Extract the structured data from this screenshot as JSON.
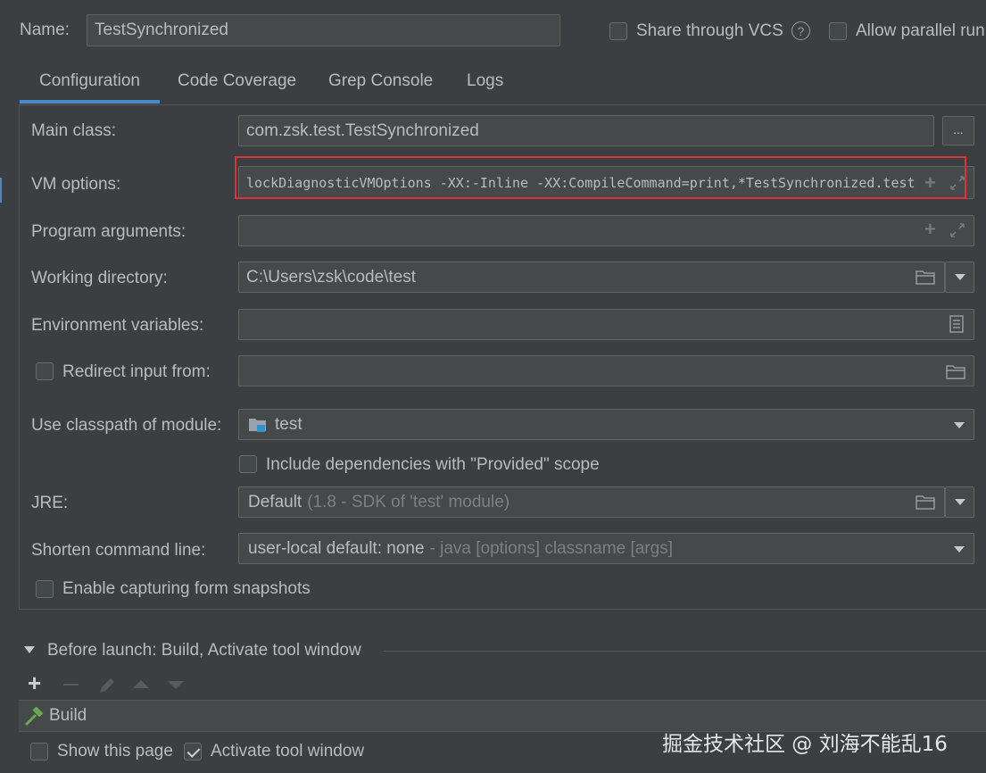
{
  "header": {
    "name_label": "Name:",
    "name_value": "TestSynchronized",
    "share_vcs_label": "Share through VCS",
    "allow_parallel_label": "Allow parallel run"
  },
  "tabs": [
    {
      "label": "Configuration",
      "active": true
    },
    {
      "label": "Code Coverage"
    },
    {
      "label": "Grep Console"
    },
    {
      "label": "Logs"
    }
  ],
  "form": {
    "main_class_label": "Main class:",
    "main_class_value": "com.zsk.test.TestSynchronized",
    "browse_label": "...",
    "vm_options_label": "VM options:",
    "vm_options_value": "lockDiagnosticVMOptions -XX:-Inline -XX:CompileCommand=print,*TestSynchronized.test",
    "program_args_label": "Program arguments:",
    "program_args_value": "",
    "working_dir_label": "Working directory:",
    "working_dir_value": "C:\\Users\\zsk\\code\\test",
    "env_vars_label": "Environment variables:",
    "env_vars_value": "",
    "redirect_label": "Redirect input from:",
    "classpath_label": "Use classpath of module:",
    "classpath_value": "test",
    "include_deps_label": "Include dependencies with \"Provided\" scope",
    "jre_label": "JRE:",
    "jre_value": "Default",
    "jre_hint": "(1.8 - SDK of 'test' module)",
    "shorten_label": "Shorten command line:",
    "shorten_value": "user-local default: none",
    "shorten_hint": "- java [options] classname [args]",
    "capture_label": "Enable capturing form snapshots"
  },
  "before_launch": {
    "title": "Before launch: Build, Activate tool window",
    "items": [
      "Build"
    ],
    "show_page_label": "Show this page",
    "activate_label": "Activate tool window"
  },
  "watermark": "掘金技术社区 @ 刘海不能乱16",
  "colors": {
    "accent_tab": "#4a88c7",
    "highlight_box": "#e0303a",
    "background": "#3c3f41",
    "field_bg": "#45494a"
  }
}
